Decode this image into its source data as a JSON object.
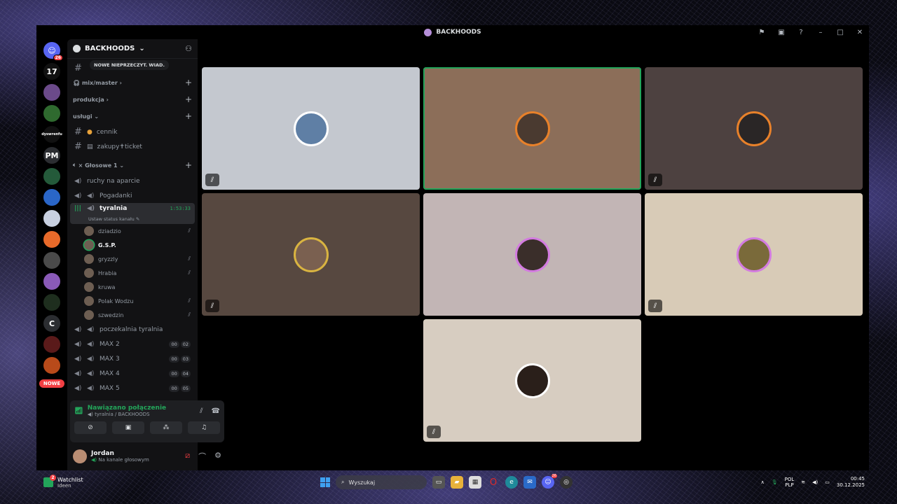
{
  "window": {
    "title": "BACKHOODS"
  },
  "rail": {
    "home_badge": "26",
    "servers": [
      {
        "label": "",
        "color": "#2b2d31"
      },
      {
        "label": "17",
        "color": "#111"
      },
      {
        "label": "",
        "color": "#6b4a8a"
      },
      {
        "label": "",
        "color": "#2f6a2f"
      },
      {
        "label": "dyswrenfu",
        "color": "#111"
      },
      {
        "label": "PM",
        "color": "#2b2d31"
      },
      {
        "label": "",
        "color": "#245a3a"
      },
      {
        "label": "",
        "color": "#2a66c8"
      },
      {
        "label": "",
        "color": "#c8d0e0"
      },
      {
        "label": "",
        "color": "#e86a2a"
      },
      {
        "label": "",
        "color": "#4a4a4a"
      },
      {
        "label": "",
        "color": "#8a5ab8"
      },
      {
        "label": "",
        "color": "#1e2e1e"
      },
      {
        "label": "C",
        "color": "#2b2d31"
      },
      {
        "label": "",
        "color": "#5a1a1a"
      },
      {
        "label": "",
        "color": "#b84a1a"
      }
    ],
    "badge_4": "4",
    "new_label": "NOWE"
  },
  "sidebar": {
    "guild_name": "BACKHOODS",
    "tooltip": "NOWE NIEPRZECZYT. WIAD.",
    "categories": {
      "mix": "mix/master",
      "produkcja": "produkcja",
      "uslugi": "usługi",
      "glosowe": "Głosowe 1"
    },
    "text_channels": {
      "cennik": "cennik",
      "zakupy": "zakupy✝ticket"
    },
    "voice_channels": {
      "ruchy": "ruchy na aparcie",
      "pogadanki": "Pogadanki",
      "tyralnia": "tyralnia",
      "tyralnia_time": "1:53:33",
      "tyralnia_status": "Ustaw status kanału",
      "poczekalnia": "poczekalnia tyralnia",
      "max": [
        {
          "name": "MAX 2",
          "a": "00",
          "b": "02"
        },
        {
          "name": "MAX 3",
          "a": "00",
          "b": "03"
        },
        {
          "name": "MAX 4",
          "a": "00",
          "b": "04"
        },
        {
          "name": "MAX 5",
          "a": "00",
          "b": "05"
        }
      ]
    },
    "users": [
      {
        "name": "dziadzio",
        "muted": true,
        "speaking": false
      },
      {
        "name": "G.S.P.",
        "muted": false,
        "speaking": true
      },
      {
        "name": "gryzzly",
        "muted": true,
        "speaking": false
      },
      {
        "name": "Hrabia",
        "muted": true,
        "speaking": false
      },
      {
        "name": "kruwa",
        "muted": false,
        "speaking": false
      },
      {
        "name": "Polak Wodzu",
        "muted": true,
        "speaking": false
      },
      {
        "name": "szwedzin",
        "muted": true,
        "speaking": false
      }
    ]
  },
  "voice_panel": {
    "status": "Nawiązano połączenie",
    "location": "tyralnia / BACKHOODS"
  },
  "user_panel": {
    "name": "Jordan",
    "status": "Na kanale głosowym"
  },
  "stage": {
    "tiles": [
      {
        "bg": "#c4c8cf",
        "ring": "",
        "muted": true,
        "speaking": false,
        "av": "#5f7fa5"
      },
      {
        "bg": "#8c6e59",
        "ring": "ring-orange",
        "muted": false,
        "speaking": true,
        "av": "#4a3a30"
      },
      {
        "bg": "#4d4140",
        "ring": "ring-orange",
        "muted": true,
        "speaking": false,
        "av": "#2a2626"
      },
      {
        "bg": "#574840",
        "ring": "ring-gold",
        "muted": true,
        "speaking": false,
        "av": "#7a6050"
      },
      {
        "bg": "#c2b5b5",
        "ring": "ring-pink",
        "muted": false,
        "speaking": false,
        "av": "#3a2e2a"
      },
      {
        "bg": "#d8cbb7",
        "ring": "ring-pink",
        "muted": true,
        "speaking": false,
        "av": "#7a6a3a"
      },
      {
        "bg": "#d7cdc1",
        "ring": "",
        "muted": true,
        "speaking": false,
        "av": "#2a1f1a"
      }
    ]
  },
  "taskbar": {
    "watch_title": "Watchlist",
    "watch_sub": "Ideen",
    "watch_badge": "2",
    "search": "Wyszukaj",
    "discord_badge": "26",
    "lang1": "POL",
    "lang2": "PLP",
    "time": "00:45",
    "date": "30.12.2025"
  }
}
